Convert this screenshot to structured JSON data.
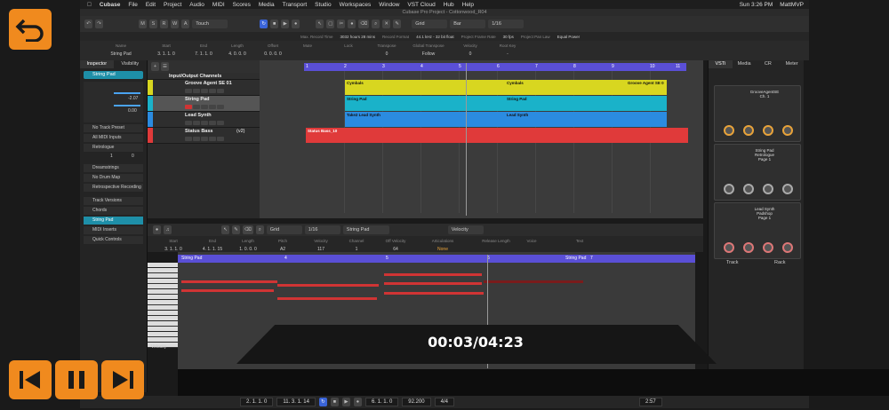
{
  "mac_menu": {
    "app": "Cubase",
    "items": [
      "File",
      "Edit",
      "Project",
      "Audio",
      "MIDI",
      "Scores",
      "Media",
      "Transport",
      "Studio",
      "Workspaces",
      "Window",
      "VST Cloud",
      "Hub",
      "Help"
    ],
    "clock": "Sun 3:26 PM",
    "user": "MattMVP"
  },
  "window_title": "Cubase Pro Project - Cottonwood_R04",
  "toolbar": {
    "mode": "Touch",
    "grid": "Grid",
    "bar": "Bar",
    "quant": "1/16",
    "msrwa": [
      "M",
      "S",
      "R",
      "W",
      "A"
    ]
  },
  "infoline": [
    "Max. Record Time",
    "3032 hours 28 mins",
    "Record Format",
    "44.1 kHz - 32 bit float",
    "Project Frame Rate",
    "30 fps",
    "Project Pan Law",
    "Equal Power"
  ],
  "event_line": {
    "cols": [
      {
        "label": "Name",
        "value": "String Pad"
      },
      {
        "label": "Start",
        "value": "3. 1. 1. 0"
      },
      {
        "label": "End",
        "value": "7. 1. 1. 0"
      },
      {
        "label": "Length",
        "value": "4. 0. 0. 0"
      },
      {
        "label": "Offset",
        "value": "0. 0. 0. 0"
      },
      {
        "label": "Mute",
        "value": ""
      },
      {
        "label": "Lock",
        "value": ""
      },
      {
        "label": "Transpose",
        "value": "0"
      },
      {
        "label": "Global Transpose",
        "value": "Follow"
      },
      {
        "label": "Velocity",
        "value": "0"
      },
      {
        "label": "Root Key",
        "value": "-"
      }
    ]
  },
  "inspector": {
    "tabs": [
      "Inspector",
      "Visibility"
    ],
    "track": "String Pad",
    "sections": [
      "No Track Preset",
      "All MIDI Inputs",
      "Retrologue",
      "Dreamstrings",
      "No Drum Map",
      "Retrospective Recording",
      "Track Versions",
      "Chords",
      "String Pad",
      "MIDI Inserts",
      "Quick Controls"
    ],
    "values": [
      "-2.07",
      "0.00",
      "1",
      "0"
    ]
  },
  "tracks": [
    {
      "name": "Input/Output Channels",
      "color": "#3a3a3a"
    },
    {
      "name": "Groove Agent SE 01",
      "color": "#d8d620"
    },
    {
      "name": "String Pad",
      "color": "#1ab2c9"
    },
    {
      "name": "Lead Synth",
      "color": "#2b8be0"
    },
    {
      "name": "Status Bass",
      "color": "#e03a3a",
      "tag": "(v2)"
    }
  ],
  "ruler_marks": [
    "1",
    "2",
    "3",
    "4",
    "5",
    "6",
    "7",
    "8",
    "9",
    "10",
    "11"
  ],
  "parts": [
    {
      "label": "Cymbals",
      "color": "#d8d620"
    },
    {
      "label": "Cymbals",
      "color": "#d8d620"
    },
    {
      "label": "Groove Agent SE 0",
      "color": "#d8d620"
    },
    {
      "label": "String Pad",
      "color": "#1ab2c9"
    },
    {
      "label": "String Pad",
      "color": "#1ab2c9"
    },
    {
      "label": "Take2 Lead Synth",
      "color": "#2b8be0"
    },
    {
      "label": "Lead Synth",
      "color": "#2b8be0"
    },
    {
      "label": "Status Bass_10",
      "color": "#e03a3a"
    }
  ],
  "rack": {
    "tabs": [
      "VSTi",
      "Media",
      "CR",
      "Meter"
    ],
    "instruments": [
      {
        "name": "GrooveAgentSE",
        "sub": "Ch. 1"
      },
      {
        "name": "String Pad",
        "sub": "Retrologue",
        "page": "Page 1"
      },
      {
        "name": "Lead Synth",
        "sub": "Padshop",
        "page": "Page 1"
      }
    ],
    "footer": [
      "Track",
      "Rack"
    ]
  },
  "editor": {
    "grid": "Grid",
    "quant": "1/16",
    "part": "String Pad",
    "lane": "Velocity",
    "info_labels": [
      "Start",
      "End",
      "Length",
      "Pitch",
      "Velocity",
      "Channel",
      "Off Velocity",
      "Articulations",
      "Release Length",
      "Voice",
      "Text"
    ],
    "info_values": [
      "3. 1. 1. 0",
      "4. 1. 1. 15",
      "1. 0. 0. 0",
      "A2",
      "117",
      "1",
      "64",
      "None",
      "",
      ""
    ],
    "ruler": [
      {
        "t": "String Pad"
      },
      {
        "t": "4"
      },
      {
        "t": "5"
      },
      {
        "t": "6"
      },
      {
        "t": "String Pad"
      },
      {
        "t": "7"
      }
    ],
    "velocity_label": "Velocity"
  },
  "video": {
    "time": "00:03/04:23"
  },
  "transport": {
    "left_loc": "2. 1. 1. 0",
    "right_loc": "11. 3. 1. 14",
    "position": "6. 1. 1. 0",
    "tempo": "92.200",
    "sig": "4/4",
    "time": "2:57"
  }
}
